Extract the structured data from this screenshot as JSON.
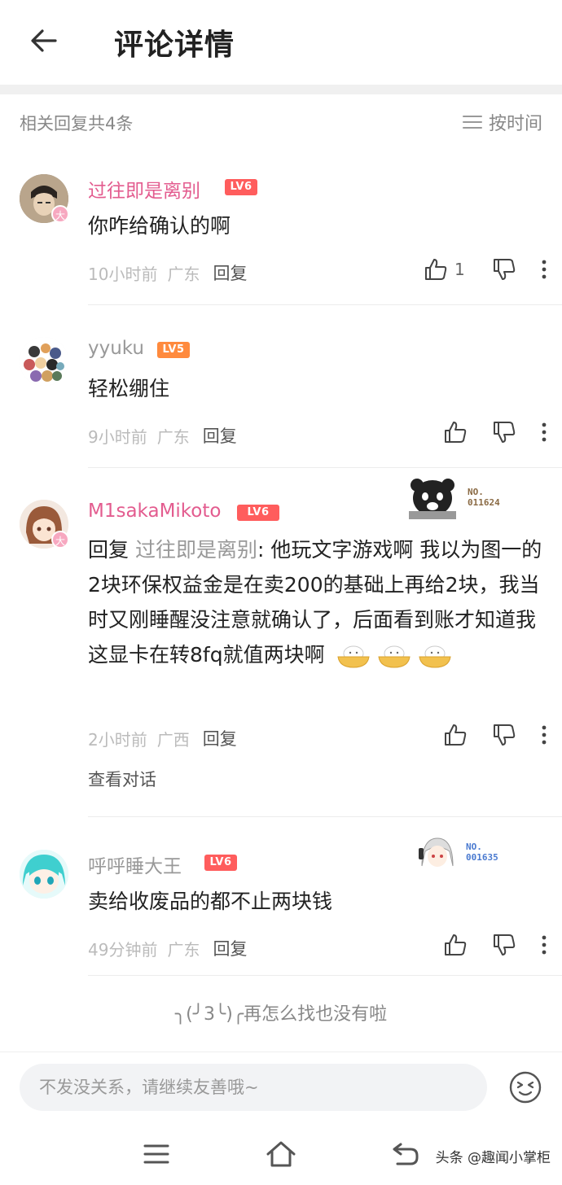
{
  "header": {
    "title": "评论详情"
  },
  "subheader": {
    "reply_count": "相关回复共4条",
    "sort_label": "按时间"
  },
  "comments": [
    {
      "username": "过往即是离别",
      "username_color": "#e35c8f",
      "level": "LV6",
      "level_color": "#ff5d5d",
      "avatar_badge": "大",
      "content": "你咋给确认的啊",
      "time": "10小时前",
      "location": "广东",
      "reply_label": "回复",
      "like_count": "1"
    },
    {
      "username": "yyuku",
      "username_color": "#999999",
      "level": "LV5",
      "level_color": "#ff8a3d",
      "content": "轻松绷住",
      "time": "9小时前",
      "location": "广东",
      "reply_label": "回复"
    },
    {
      "username": "M1sakaMikoto",
      "username_color": "#e35c8f",
      "level": "LV6",
      "level_color": "#ff5d5d",
      "avatar_badge": "大",
      "reply_prefix": "回复 ",
      "reply_target": "过往即是离别",
      "content": ": 他玩文字游戏啊 我以为图一的2块环保权益金是在卖200的基础上再给2块，我当时又刚睡醒没注意就确认了，后面看到账才知道我这显卡在转8fq就值两块啊",
      "time": "2小时前",
      "location": "广西",
      "reply_label": "回复",
      "view_conversation": "查看对话",
      "nft_no_label": "NO.",
      "nft_no": "011624"
    },
    {
      "username": "呼呼睡大王",
      "username_color": "#999999",
      "level": "LV6",
      "level_color": "#ff5d5d",
      "content": "卖给收废品的都不止两块钱",
      "time": "49分钟前",
      "location": "广东",
      "reply_label": "回复",
      "nft_no_label": "NO.",
      "nft_no": "001635"
    }
  ],
  "end_text": "╮(╯3╰)╭再怎么找也没有啦",
  "input": {
    "placeholder": "不发没关系，请继续友善哦~"
  },
  "watermark": "头条 @趣闻小掌柜"
}
